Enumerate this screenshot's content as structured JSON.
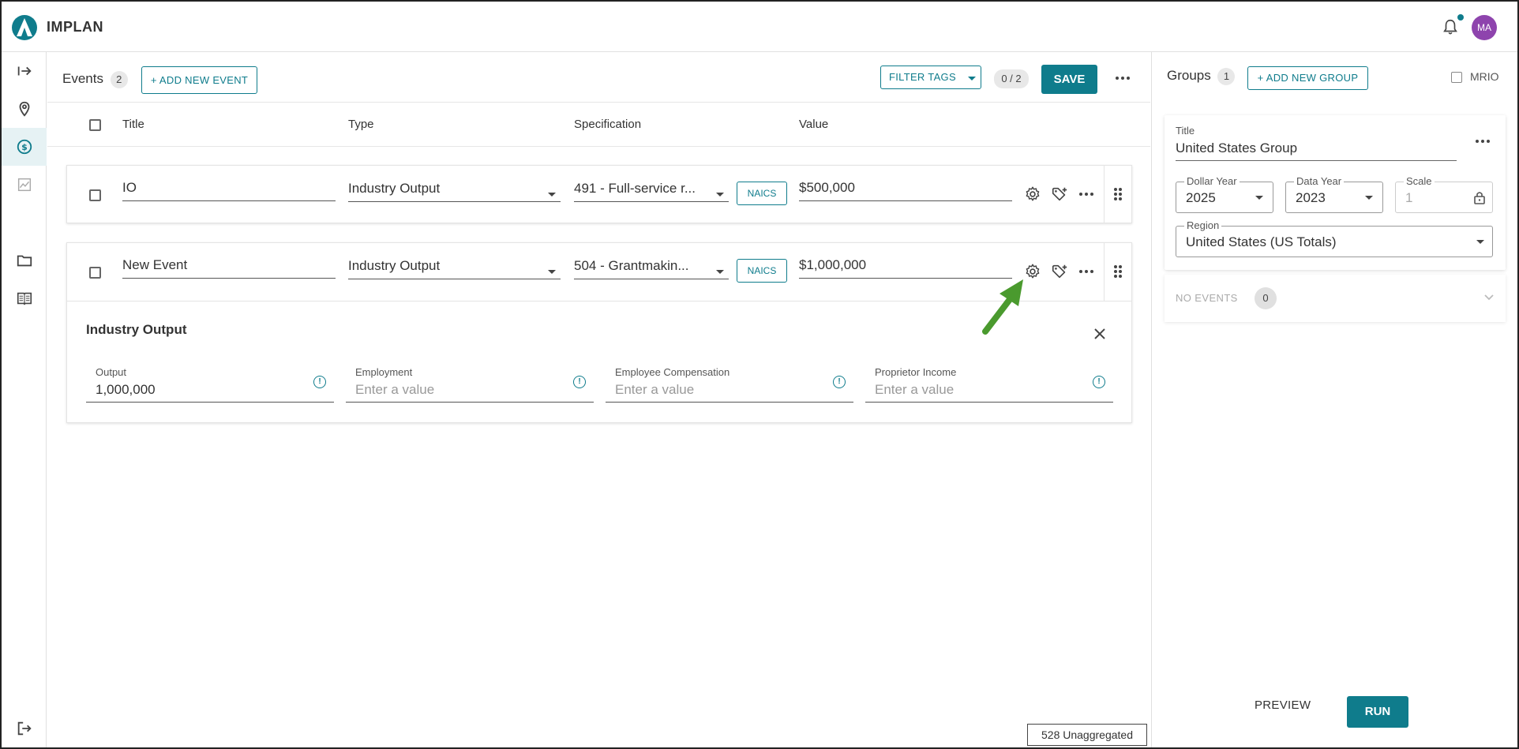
{
  "app": {
    "brand": "IMPLAN",
    "avatar_initials": "MA",
    "accent": "#0f7c8c",
    "avatar_color": "#8e44ad"
  },
  "rail": {
    "icons": [
      "collapse-arrow-icon",
      "location-pin-icon",
      "dollar-icon",
      "chart-icon",
      "folder-icon",
      "book-icon",
      "logout-icon"
    ]
  },
  "events": {
    "title": "Events",
    "count": "2",
    "add_label": "+ ADD NEW EVENT",
    "filter_label": "FILTER TAGS",
    "selection_count": "0 / 2",
    "save_label": "SAVE",
    "columns": {
      "title": "Title",
      "type": "Type",
      "specification": "Specification",
      "value": "Value"
    },
    "rows": [
      {
        "title": "IO",
        "type": "Industry Output",
        "specification": "491 - Full-service r...",
        "naics": "NAICS",
        "value": "$500,000"
      },
      {
        "title": "New Event",
        "type": "Industry Output",
        "specification": "504 - Grantmakin...",
        "naics": "NAICS",
        "value": "$1,000,000"
      }
    ],
    "detail": {
      "title": "Industry Output",
      "fields": [
        {
          "label": "Output",
          "value": "1,000,000",
          "placeholder": ""
        },
        {
          "label": "Employment",
          "value": "",
          "placeholder": "Enter a value"
        },
        {
          "label": "Employee Compensation",
          "value": "",
          "placeholder": "Enter a value"
        },
        {
          "label": "Proprietor Income",
          "value": "",
          "placeholder": "Enter a value"
        }
      ]
    },
    "unaggregated": "528 Unaggregated"
  },
  "groups": {
    "title": "Groups",
    "count": "1",
    "add_label": "+ ADD NEW GROUP",
    "mrio_label": "MRIO",
    "card": {
      "title_label": "Title",
      "title_value": "United States Group",
      "dollar_year_label": "Dollar Year",
      "dollar_year": "2025",
      "data_year_label": "Data Year",
      "data_year": "2023",
      "scale_label": "Scale",
      "scale_value": "1",
      "region_label": "Region",
      "region_value": "United States (US Totals)"
    },
    "no_events_label": "NO EVENTS",
    "no_events_count": "0",
    "preview_label": "PREVIEW",
    "run_label": "RUN"
  }
}
